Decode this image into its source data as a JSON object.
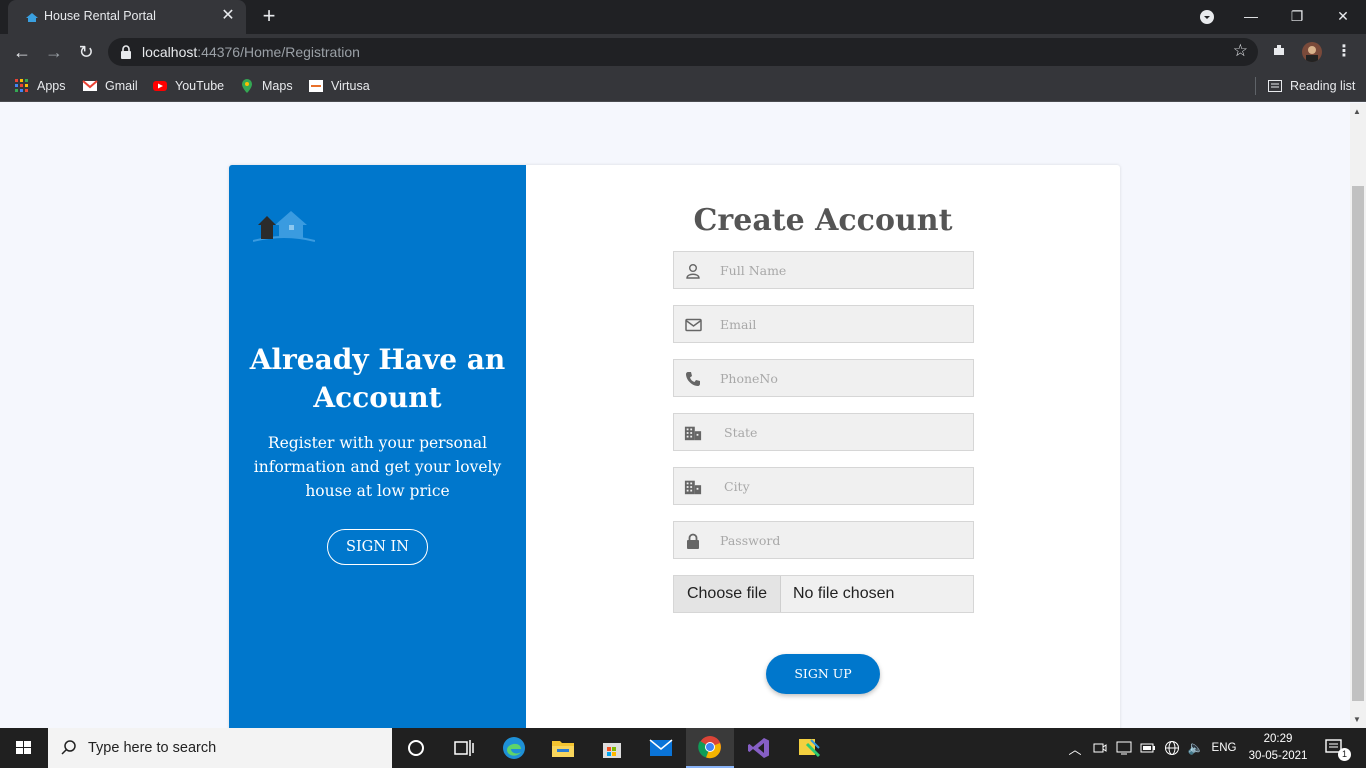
{
  "browser": {
    "tab_title": "House Rental Portal",
    "url_host": "localhost",
    "url_rest": ":44376/Home/Registration",
    "bookmarks": [
      "Apps",
      "Gmail",
      "YouTube",
      "Maps",
      "Virtusa"
    ],
    "reading_list": "Reading list"
  },
  "left_panel": {
    "heading": "Already Have an Account",
    "text": "Register with your personal information and get your lovely house at low price",
    "signin_label": "SIGN IN"
  },
  "form": {
    "title": "Create Account",
    "fields": [
      {
        "placeholder": "Full Name",
        "icon": "user-icon"
      },
      {
        "placeholder": "Email",
        "icon": "envelope-icon"
      },
      {
        "placeholder": "PhoneNo",
        "icon": "phone-icon"
      },
      {
        "placeholder": "State",
        "icon": "building-icon"
      },
      {
        "placeholder": "City",
        "icon": "building-icon"
      },
      {
        "placeholder": "Password",
        "icon": "lock-icon"
      }
    ],
    "file_button": "Choose file",
    "file_status": "No file chosen",
    "signup_label": "SIGN UP"
  },
  "taskbar": {
    "search_placeholder": "Type here to search",
    "language": "ENG",
    "time": "20:29",
    "date": "30-05-2021",
    "notification_count": "1"
  },
  "colors": {
    "brand_blue": "#0077cc",
    "page_bg": "#f5f7fd"
  }
}
